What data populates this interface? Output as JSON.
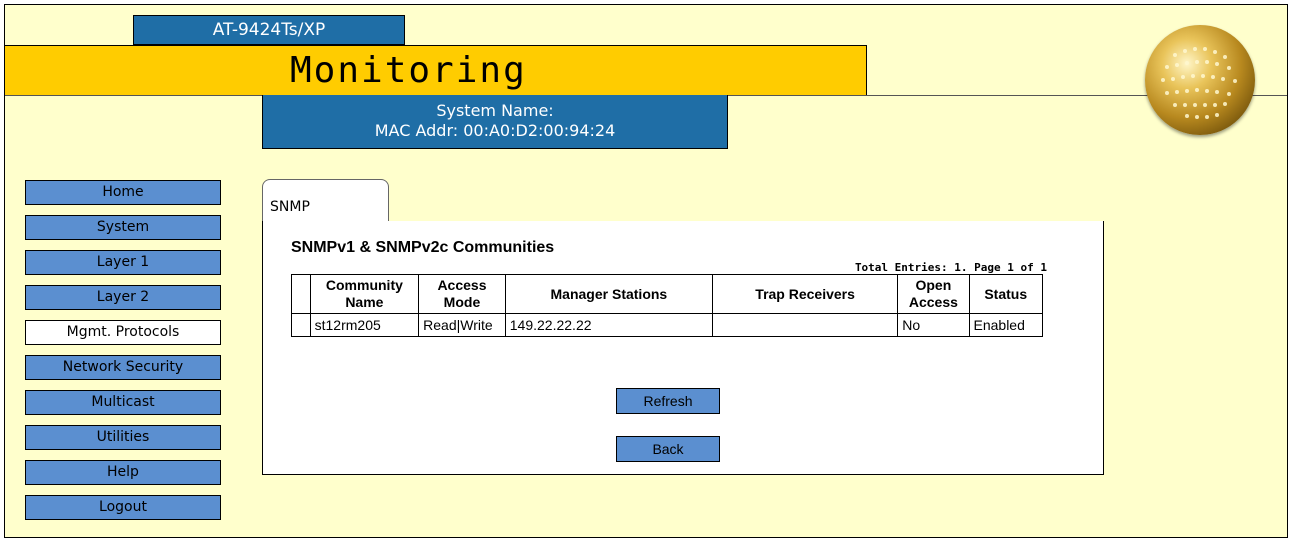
{
  "header": {
    "model": "AT-9424Ts/XP",
    "title": "Monitoring",
    "system_name_label": "System Name:",
    "mac_line": "MAC Addr: 00:A0:D2:00:94:24"
  },
  "colors": {
    "background": "#ffffcc",
    "banner": "#ffcc00",
    "header_blue": "#1f6ea6",
    "nav_button": "#5b8fd0"
  },
  "sidebar": {
    "items": [
      {
        "label": "Home"
      },
      {
        "label": "System"
      },
      {
        "label": "Layer 1"
      },
      {
        "label": "Layer 2"
      },
      {
        "label": "Mgmt. Protocols",
        "active": true
      },
      {
        "label": "Network Security"
      },
      {
        "label": "Multicast"
      },
      {
        "label": "Utilities"
      },
      {
        "label": "Help"
      },
      {
        "label": "Logout"
      }
    ]
  },
  "tab": {
    "label": "SNMP"
  },
  "section": {
    "title": "SNMPv1 & SNMPv2c Communities",
    "total": "Total Entries: 1. Page 1 of 1"
  },
  "table": {
    "headers": {
      "community_name": "Community Name",
      "access_mode": "Access Mode",
      "manager_stations": "Manager Stations",
      "trap_receivers": "Trap Receivers",
      "open_access": "Open Access",
      "status": "Status"
    },
    "rows": [
      {
        "community_name": "st12rm205",
        "access_mode": "Read|Write",
        "manager_stations": "149.22.22.22",
        "trap_receivers": "",
        "open_access": "No",
        "status": "Enabled"
      }
    ]
  },
  "buttons": {
    "refresh": "Refresh",
    "back": "Back"
  }
}
